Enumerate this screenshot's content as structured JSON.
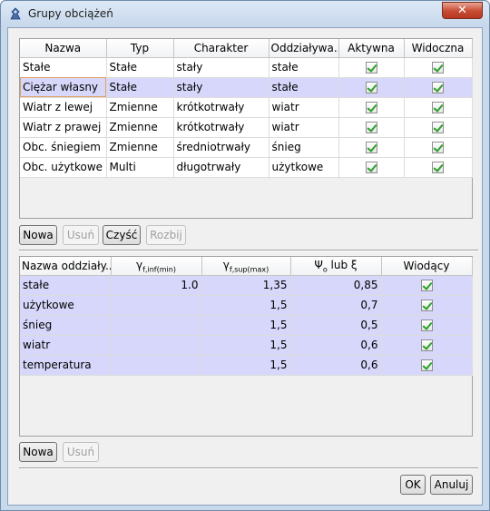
{
  "window": {
    "title": "Grupy obciążeń",
    "close_label": "✕"
  },
  "groups_table": {
    "columns": [
      "Nazwa",
      "Typ",
      "Charakter",
      "Oddziaływa...",
      "Aktywna",
      "Widoczna"
    ],
    "rows": [
      {
        "nazwa": "Stałe",
        "typ": "Stałe",
        "charakter": "stały",
        "oddzialywanie": "stałe",
        "aktywna": true,
        "widoczna": true
      },
      {
        "nazwa": "Ciężar własny",
        "typ": "Stałe",
        "charakter": "stały",
        "oddzialywanie": "stałe",
        "aktywna": true,
        "widoczna": true
      },
      {
        "nazwa": "Wiatr z lewej",
        "typ": "Zmienne",
        "charakter": "krótkotrwały",
        "oddzialywanie": "wiatr",
        "aktywna": true,
        "widoczna": true
      },
      {
        "nazwa": "Wiatr z prawej",
        "typ": "Zmienne",
        "charakter": "krótkotrwały",
        "oddzialywanie": "wiatr",
        "aktywna": true,
        "widoczna": true
      },
      {
        "nazwa": "Obc. śniegiem",
        "typ": "Zmienne",
        "charakter": "średniotrwały",
        "oddzialywanie": "śnieg",
        "aktywna": true,
        "widoczna": true
      },
      {
        "nazwa": "Obc. użytkowe",
        "typ": "Multi",
        "charakter": "długotrwały",
        "oddzialywanie": "użytkowe",
        "aktywna": true,
        "widoczna": true
      }
    ],
    "selected_row": 1
  },
  "groups_buttons": {
    "new": "Nowa",
    "delete": "Usuń",
    "clear": "Czyść",
    "split": "Rozbij"
  },
  "actions_table": {
    "columns": {
      "name": "Nazwa oddziały...",
      "gamma_inf": "γ",
      "gamma_inf_sub": "f,inf(min)",
      "gamma_sup": "γ",
      "gamma_sup_sub": "f,sup(max)",
      "psi": "Ψ",
      "psi_sub": "o",
      "psi_suffix": " lub ξ",
      "leading": "Wiodący"
    },
    "rows": [
      {
        "name": "stałe",
        "gamma_inf": "1.0",
        "gamma_sup": "1,35",
        "psi": "0,85",
        "leading": true
      },
      {
        "name": "użytkowe",
        "gamma_inf": "",
        "gamma_sup": "1,5",
        "psi": "0,7",
        "leading": true
      },
      {
        "name": "śnieg",
        "gamma_inf": "",
        "gamma_sup": "1,5",
        "psi": "0,5",
        "leading": true
      },
      {
        "name": "wiatr",
        "gamma_inf": "",
        "gamma_sup": "1,5",
        "psi": "0,6",
        "leading": true
      },
      {
        "name": "temperatura",
        "gamma_inf": "",
        "gamma_sup": "1,5",
        "psi": "0,6",
        "leading": true
      }
    ]
  },
  "actions_buttons": {
    "new": "Nowa",
    "delete": "Usuń"
  },
  "dialog_buttons": {
    "ok": "OK",
    "cancel": "Anuluj"
  },
  "colors": {
    "selected_row": "#d7d7fb",
    "check_green": "#2aa02a"
  }
}
